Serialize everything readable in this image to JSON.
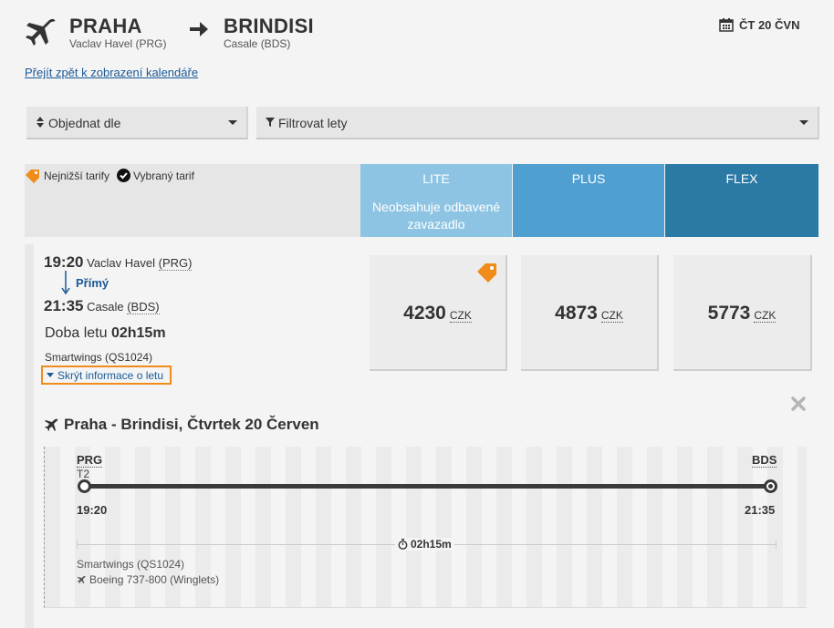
{
  "header": {
    "from_city": "PRAHA",
    "from_airport": "Vaclav Havel (PRG)",
    "to_city": "BRINDISI",
    "to_airport": "Casale (BDS)",
    "date": "ČT 20 ČVN"
  },
  "back_link": "Přejít zpět k zobrazení kalendáře",
  "controls": {
    "sort_label": "Objednat dle",
    "filter_label": "Filtrovat lety"
  },
  "legend": {
    "lowest_fare": "Nejnižší tarify",
    "selected_fare": "Vybraný tarif"
  },
  "fares": [
    {
      "name": "LITE",
      "description": "Neobsahuje odbavené zavazadlo",
      "color": "#8ec4e3"
    },
    {
      "name": "PLUS",
      "description": "",
      "color": "#4fa0d0"
    },
    {
      "name": "FLEX",
      "description": "",
      "color": "#2b7aa6"
    }
  ],
  "flight": {
    "dep_time": "19:20",
    "dep_airport": "Vaclav Havel",
    "dep_code": "(PRG)",
    "direct_label": "Přímý",
    "arr_time": "21:35",
    "arr_airport": "Casale",
    "arr_code": "(BDS)",
    "duration_label": "Doba letu",
    "duration": "02h15m",
    "carrier": "Smartwings (QS1024)",
    "hide_info": "Skrýt informace o letu"
  },
  "prices": [
    {
      "amount": "4230",
      "currency": "CZK",
      "lowest": true
    },
    {
      "amount": "4873",
      "currency": "CZK",
      "lowest": false
    },
    {
      "amount": "5773",
      "currency": "CZK",
      "lowest": false
    }
  ],
  "detail": {
    "title": "Praha - Brindisi, Čtvrtek 20 Červen",
    "origin_code": "PRG",
    "origin_terminal": "T2",
    "dest_code": "BDS",
    "dep_time": "19:20",
    "arr_time": "21:35",
    "duration": "02h15m",
    "carrier": "Smartwings (QS1024)",
    "aircraft": "Boeing 737-800 (Winglets)"
  },
  "colors": {
    "accent_orange": "#f08c1a",
    "link_blue": "#1a5a96"
  }
}
